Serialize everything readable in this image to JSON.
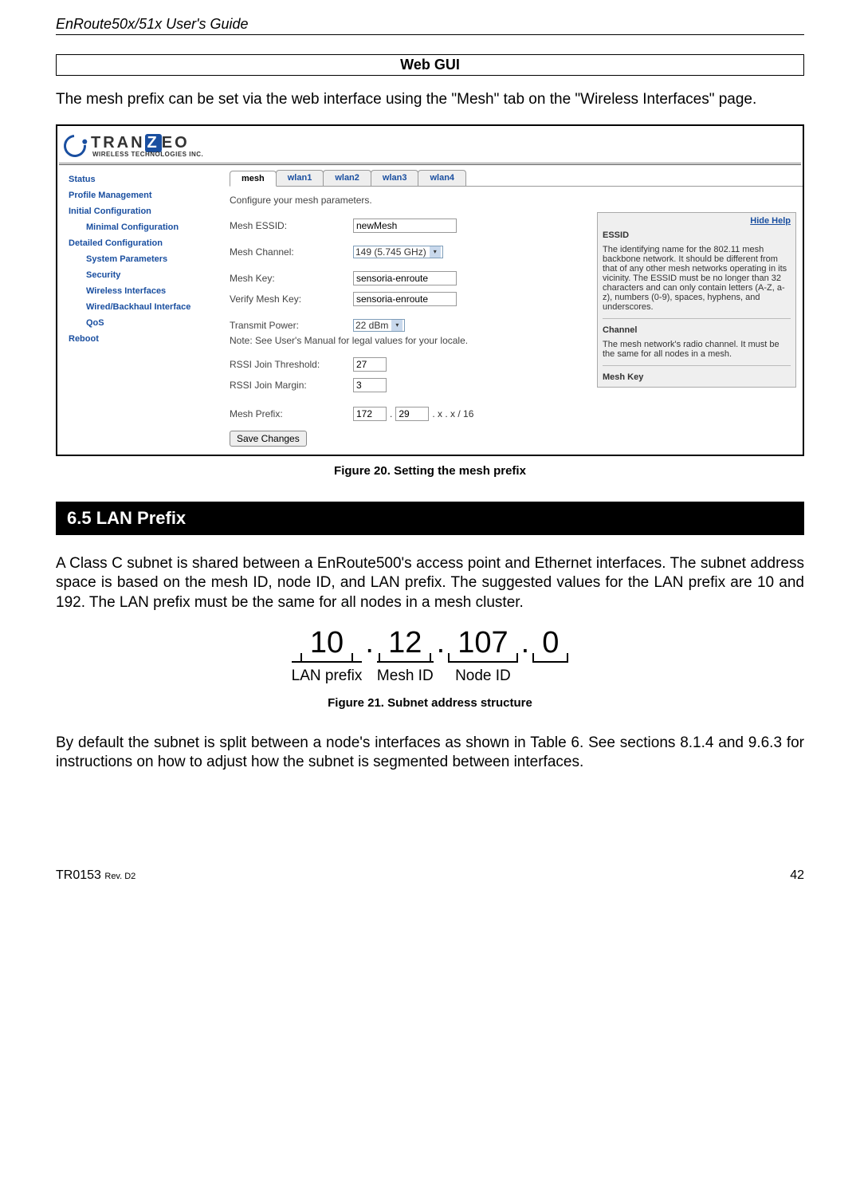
{
  "doc": {
    "header": "EnRoute50x/51x User's Guide",
    "webgui_label": "Web GUI",
    "intro_text": "The mesh prefix can be set via the web interface using the \"Mesh\" tab on the \"Wireless Interfaces\" page.",
    "fig20_caption": "Figure 20. Setting the mesh prefix",
    "section65": "6.5    LAN Prefix",
    "lan_text": "A Class C subnet is shared between a EnRoute500's access point and Ethernet interfaces. The subnet address space is based on the mesh ID, node ID, and LAN prefix. The suggested values for the LAN prefix are 10 and 192. The LAN prefix must be the same for all nodes in a mesh cluster.",
    "fig21_caption": "Figure 21. Subnet address structure",
    "closing_text": "By default the subnet is split between a node's interfaces as shown in Table 6. See sections 8.1.4 and 9.6.3 for instructions on how to adjust how the subnet is segmented between interfaces.",
    "footer_left": "TR0153 ",
    "footer_rev": "Rev. D2",
    "footer_page": "42"
  },
  "screenshot": {
    "logo_main_pre": "TRAN",
    "logo_main_z": "Z",
    "logo_main_post": "EO",
    "logo_sub": "WIRELESS  TECHNOLOGIES INC.",
    "sidebar": [
      {
        "label": "Status",
        "indent": false
      },
      {
        "label": "Profile Management",
        "indent": false
      },
      {
        "label": "Initial Configuration",
        "indent": false
      },
      {
        "label": "Minimal Configuration",
        "indent": true
      },
      {
        "label": "Detailed Configuration",
        "indent": false
      },
      {
        "label": "System Parameters",
        "indent": true
      },
      {
        "label": "Security",
        "indent": true
      },
      {
        "label": "Wireless Interfaces",
        "indent": true
      },
      {
        "label": "Wired/Backhaul Interface",
        "indent": true
      },
      {
        "label": "QoS",
        "indent": true
      },
      {
        "label": "Reboot",
        "indent": false
      }
    ],
    "tabs": [
      "mesh",
      "wlan1",
      "wlan2",
      "wlan3",
      "wlan4"
    ],
    "config_intro": "Configure your mesh parameters.",
    "fields": {
      "essid_label": "Mesh ESSID:",
      "essid_value": "newMesh",
      "channel_label": "Mesh Channel:",
      "channel_value": "149 (5.745 GHz)",
      "key_label": "Mesh Key:",
      "key_value": "sensoria-enroute",
      "vkey_label": "Verify Mesh Key:",
      "vkey_value": "sensoria-enroute",
      "tx_label": "Transmit Power:",
      "tx_value": "22 dBm",
      "tx_note": "Note: See User's Manual for legal values for your locale.",
      "rssi_t_label": "RSSI Join Threshold:",
      "rssi_t_value": "27",
      "rssi_m_label": "RSSI Join Margin:",
      "rssi_m_value": "3",
      "prefix_label": "Mesh Prefix:",
      "prefix_a": "172",
      "prefix_b": "29",
      "prefix_suffix": " . x . x / 16",
      "save_btn": "Save Changes"
    },
    "help": {
      "hide": "Hide Help",
      "essid_title": "ESSID",
      "essid_body": "The identifying name for the 802.11 mesh backbone network. It should be different from that of any other mesh networks operating in its vicinity. The ESSID must be no longer than 32 characters and can only contain letters (A-Z, a-z), numbers (0-9), spaces, hyphens, and underscores.",
      "channel_title": "Channel",
      "channel_body": "The mesh network's radio channel. It must be the same for all nodes in a mesh.",
      "key_title": "Mesh Key"
    }
  },
  "subnet": {
    "n1": "10",
    "n2": "12",
    "n3": "107",
    "n4": "0",
    "l1": "LAN prefix",
    "l2": "Mesh ID",
    "l3": "Node ID"
  }
}
